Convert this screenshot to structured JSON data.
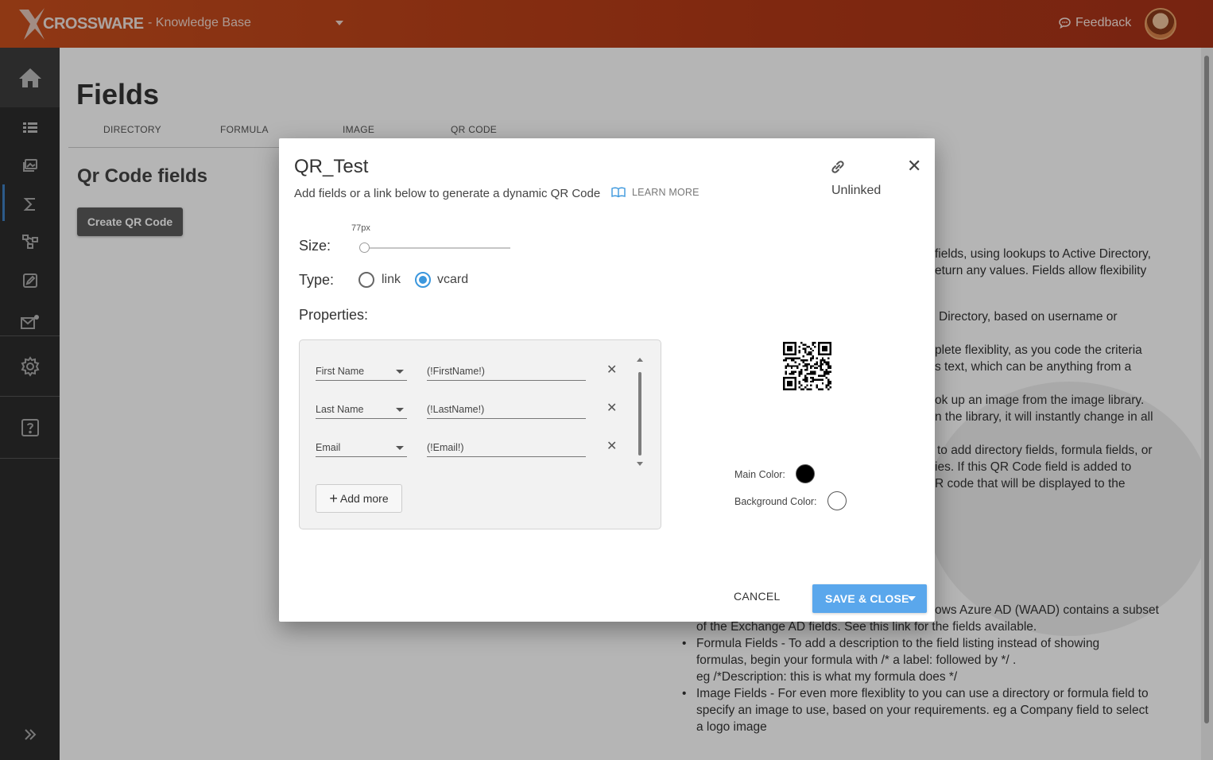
{
  "header": {
    "brand": "CROSSWARE",
    "app_title": "- Knowledge Base",
    "feedback_label": "Feedback"
  },
  "page": {
    "title": "Fields",
    "tabs": [
      {
        "label": "DIRECTORY"
      },
      {
        "label": "FORMULA"
      },
      {
        "label": "IMAGE"
      },
      {
        "label": "QR CODE"
      }
    ],
    "section_title": "Qr Code fields",
    "create_button": "Create QR Code",
    "desc_lines": [
      "fields, using lookups to Active Directory,",
      "eturn any values. Fields allow flexibility",
      "Directory, based on username or",
      "plete flexiblity, as you code the criteria",
      "s text, which can be anything from a",
      "ok up an image from the image library.",
      "n the library, it will instantly change in all",
      "to add directory fields, formula fields, or",
      "ies. If this QR Code field is added to",
      "R code that will be displayed to the",
      "ows Azure AD (WAAD) contains a subset",
      "of the Exchange AD fields. See this link for the fields available.",
      "Formula Fields - To add a description to the field listing instead of showing",
      "formulas, begin your formula with /* a label: followed by */ .",
      "eg /*Description: this is what my formula does */",
      "Image Fields - For even more flexiblity to you can use a directory or formula field to",
      "specify an image to use, based on your requirements. eg a Company field to select",
      "a logo image"
    ]
  },
  "modal": {
    "title": "QR_Test",
    "subtitle": "Add fields or a link below to generate a dynamic QR Code",
    "learn_more": "LEARN MORE",
    "link_status": "Unlinked",
    "size_label": "Size:",
    "size_value": "77px",
    "size_fraction": 0.0,
    "type_label": "Type:",
    "type_options": [
      {
        "label": "link",
        "selected": false
      },
      {
        "label": "vcard",
        "selected": true
      }
    ],
    "properties_label": "Properties:",
    "properties": [
      {
        "field": "First Name",
        "value": "(!FirstName!)"
      },
      {
        "field": "Last Name",
        "value": "(!LastName!)"
      },
      {
        "field": "Email",
        "value": "(!Email!)"
      }
    ],
    "add_more": "Add more",
    "main_color_label": "Main Color:",
    "main_color": "#000000",
    "background_color_label": "Background Color:",
    "background_color": "#ffffff",
    "cancel": "CANCEL",
    "save": "SAVE & CLOSE"
  },
  "colors": {
    "header": "#c0441b",
    "accent": "#5aa7ec",
    "sidebar": "#2d2d2d"
  }
}
